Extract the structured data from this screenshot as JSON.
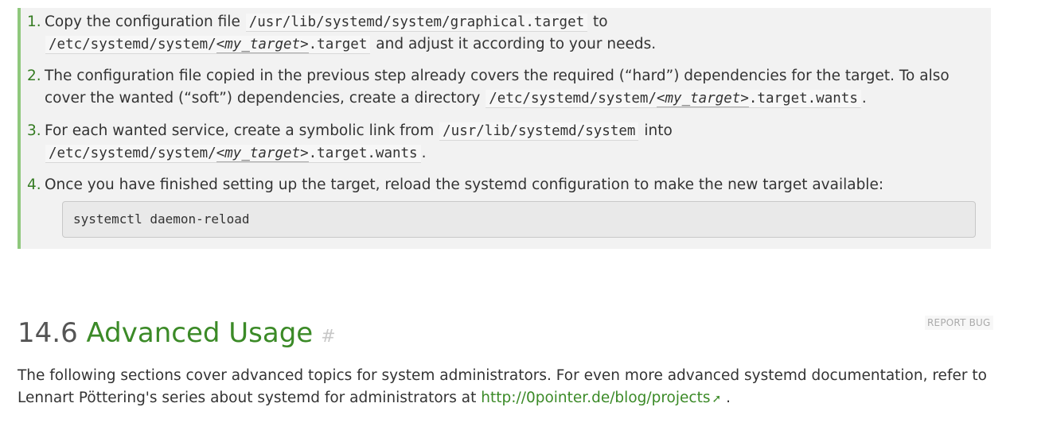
{
  "procedure": {
    "steps": [
      {
        "num": "1.",
        "t1": "Copy the configuration file ",
        "c1": "/usr/lib/systemd/system/graphical.target",
        "t2": " to",
        "c2a": "/etc/systemd/system/",
        "c2rep": "<my_target>",
        "c2b": ".target",
        "t3": " and adjust it according to your needs."
      },
      {
        "num": "2.",
        "t1": "The configuration file copied in the previous step already covers the required (“hard”) dependencies for the target. To also cover the wanted (“soft”) dependencies, create a directory ",
        "ca": "/etc/systemd/system/",
        "crep": "<my_target>",
        "cb": ".target.wants",
        "t2": "."
      },
      {
        "num": "3.",
        "t1": "For each wanted service, create a symbolic link from ",
        "c1": "/usr/lib/systemd/system",
        "t2": " into",
        "c2a": "/etc/systemd/system/",
        "c2rep": "<my_target>",
        "c2b": ".target.wants",
        "t3": "."
      },
      {
        "num": "4.",
        "t1": "Once you have finished setting up the target, reload the systemd configuration to make the new target available:",
        "command": "systemctl daemon-reload"
      }
    ]
  },
  "section": {
    "number": "14.6",
    "title": "Advanced Usage",
    "permalink": "#",
    "report_bug": "REPORT BUG"
  },
  "intro": {
    "text": "The following sections cover advanced topics for system administrators. For even more advanced systemd documentation, refer to Lennart Pöttering's series about systemd for administrators at ",
    "link": "http://0pointer.de/blog/projects",
    "trail": "."
  }
}
